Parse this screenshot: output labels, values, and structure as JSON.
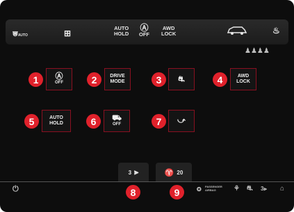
{
  "topbar": {
    "rear_defrost_auto_sub": "AUTO",
    "auto_hold": "AUTO\nHOLD",
    "off_label": "OFF",
    "awd_lock": "AWD\nLOCK"
  },
  "seat_icons": "♟♟♟♟",
  "tiles": [
    {
      "num": "1",
      "label": "OFF"
    },
    {
      "num": "2",
      "label": "DRIVE\nMODE"
    },
    {
      "num": "3",
      "label": ""
    },
    {
      "num": "4",
      "label": "AWD\nLOCK"
    },
    {
      "num": "5",
      "label": "AUTO\nHOLD"
    },
    {
      "num": "6",
      "label": "OFF"
    },
    {
      "num": "7",
      "label": ""
    }
  ],
  "bottom": {
    "headlight_level": "3",
    "mirror_value": "20",
    "num_8": "8",
    "num_9": "9"
  },
  "status": {
    "passenger_airbag_line1": "PASSENGER",
    "passenger_airbag_line2": "AIRBAG",
    "headlight_level": "3"
  },
  "colors": {
    "accent": "#e0212b",
    "tile_border": "#8a1020"
  }
}
